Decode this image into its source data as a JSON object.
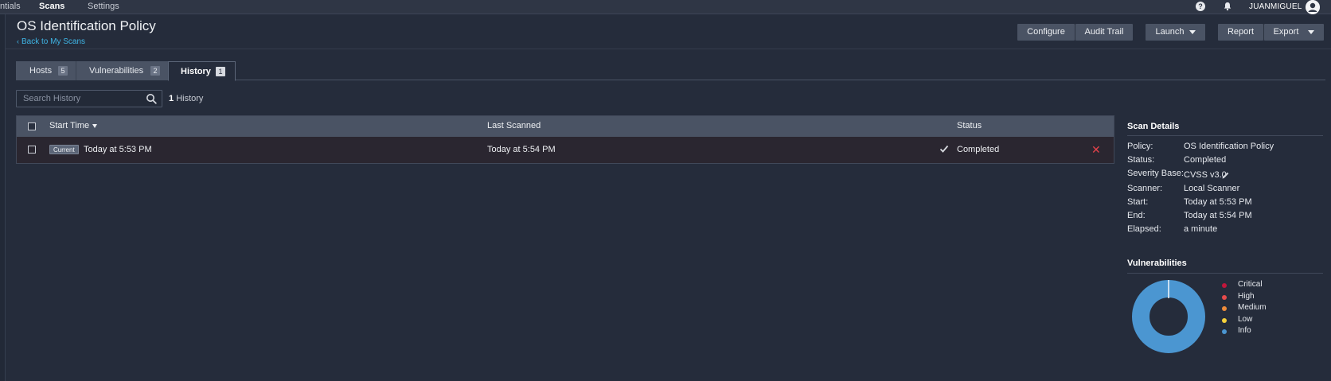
{
  "topnav": {
    "items": [
      "ntials",
      "Scans",
      "Settings"
    ],
    "help_icon": "help-icon",
    "bell_icon": "bell-icon",
    "username": "JUANMIGUEL"
  },
  "header": {
    "title": "OS Identification Policy",
    "back_link": "Back to My Scans",
    "buttons": {
      "configure": "Configure",
      "audit_trail": "Audit Trail",
      "launch": "Launch",
      "report": "Report",
      "export": "Export"
    }
  },
  "tabs": [
    {
      "label": "Hosts",
      "count": "5"
    },
    {
      "label": "Vulnerabilities",
      "count": "2"
    },
    {
      "label": "History",
      "count": "1"
    }
  ],
  "search": {
    "placeholder": "Search History",
    "result_count": "1",
    "result_label": "History"
  },
  "table": {
    "columns": [
      "Start Time",
      "Last Scanned",
      "Status"
    ],
    "rows": [
      {
        "badge": "Current",
        "start_time": "Today at 5:53 PM",
        "last_scanned": "Today at 5:54 PM",
        "status": "Completed"
      }
    ]
  },
  "scan_details": {
    "title": "Scan Details",
    "fields": [
      {
        "key": "Policy:",
        "value": "OS Identification Policy"
      },
      {
        "key": "Status:",
        "value": "Completed"
      },
      {
        "key": "Severity Base:",
        "value": "CVSS v3.0"
      },
      {
        "key": "Scanner:",
        "value": "Local Scanner"
      },
      {
        "key": "Start:",
        "value": "Today at 5:53 PM"
      },
      {
        "key": "End:",
        "value": "Today at 5:54 PM"
      },
      {
        "key": "Elapsed:",
        "value": "a minute"
      }
    ]
  },
  "vulnerabilities": {
    "title": "Vulnerabilities",
    "legend": [
      {
        "label": "Critical",
        "color": "#c0163b"
      },
      {
        "label": "High",
        "color": "#e64b4b"
      },
      {
        "label": "Medium",
        "color": "#f08c3a"
      },
      {
        "label": "Low",
        "color": "#f5d13b"
      },
      {
        "label": "Info",
        "color": "#4b96d1"
      }
    ],
    "donut_colors": {
      "info": "#4b96d1",
      "gap": "#ffffff"
    }
  }
}
